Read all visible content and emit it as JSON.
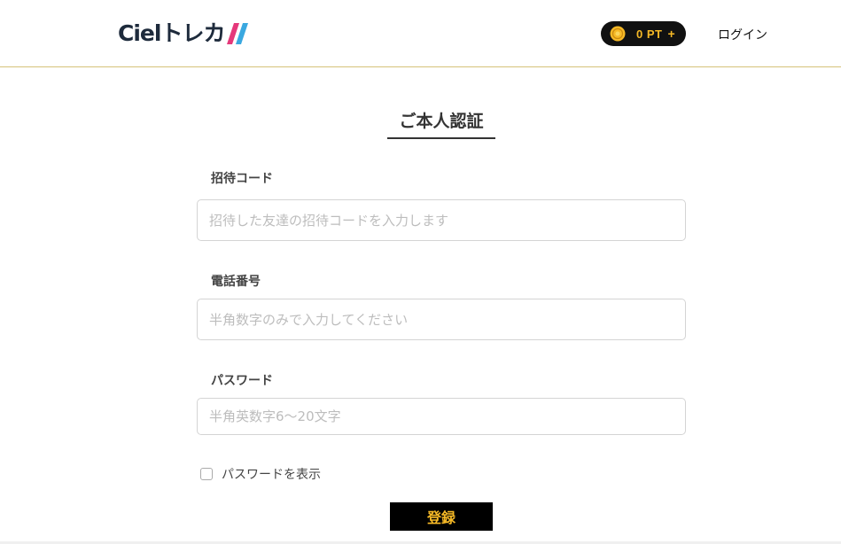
{
  "header": {
    "logo_text": "Cielトレカ",
    "points_label": "0 PT",
    "points_add": "+",
    "login_label": "ログイン"
  },
  "main": {
    "title": "ご本人認証",
    "fields": [
      {
        "label": "招待コード",
        "placeholder": "招待した友達の招待コードを入力します",
        "value": ""
      },
      {
        "label": "電話番号",
        "placeholder": "半角数字のみで入力してください",
        "value": ""
      },
      {
        "label": "パスワード",
        "placeholder": "半角英数字6〜20文字",
        "value": ""
      }
    ],
    "show_password_label": "パスワードを表示",
    "show_password_checked": false,
    "submit_label": "登録"
  },
  "colors": {
    "accent": "#f6b926",
    "brand_dark": "#1e2b3c",
    "slash_pink": "#e5387a",
    "slash_blue": "#3aa8e0",
    "header_border": "#d6c27a"
  },
  "icons": {
    "coin": "coin-icon",
    "logo_slash": "logo-slash-icon",
    "checkbox": "checkbox-icon"
  }
}
